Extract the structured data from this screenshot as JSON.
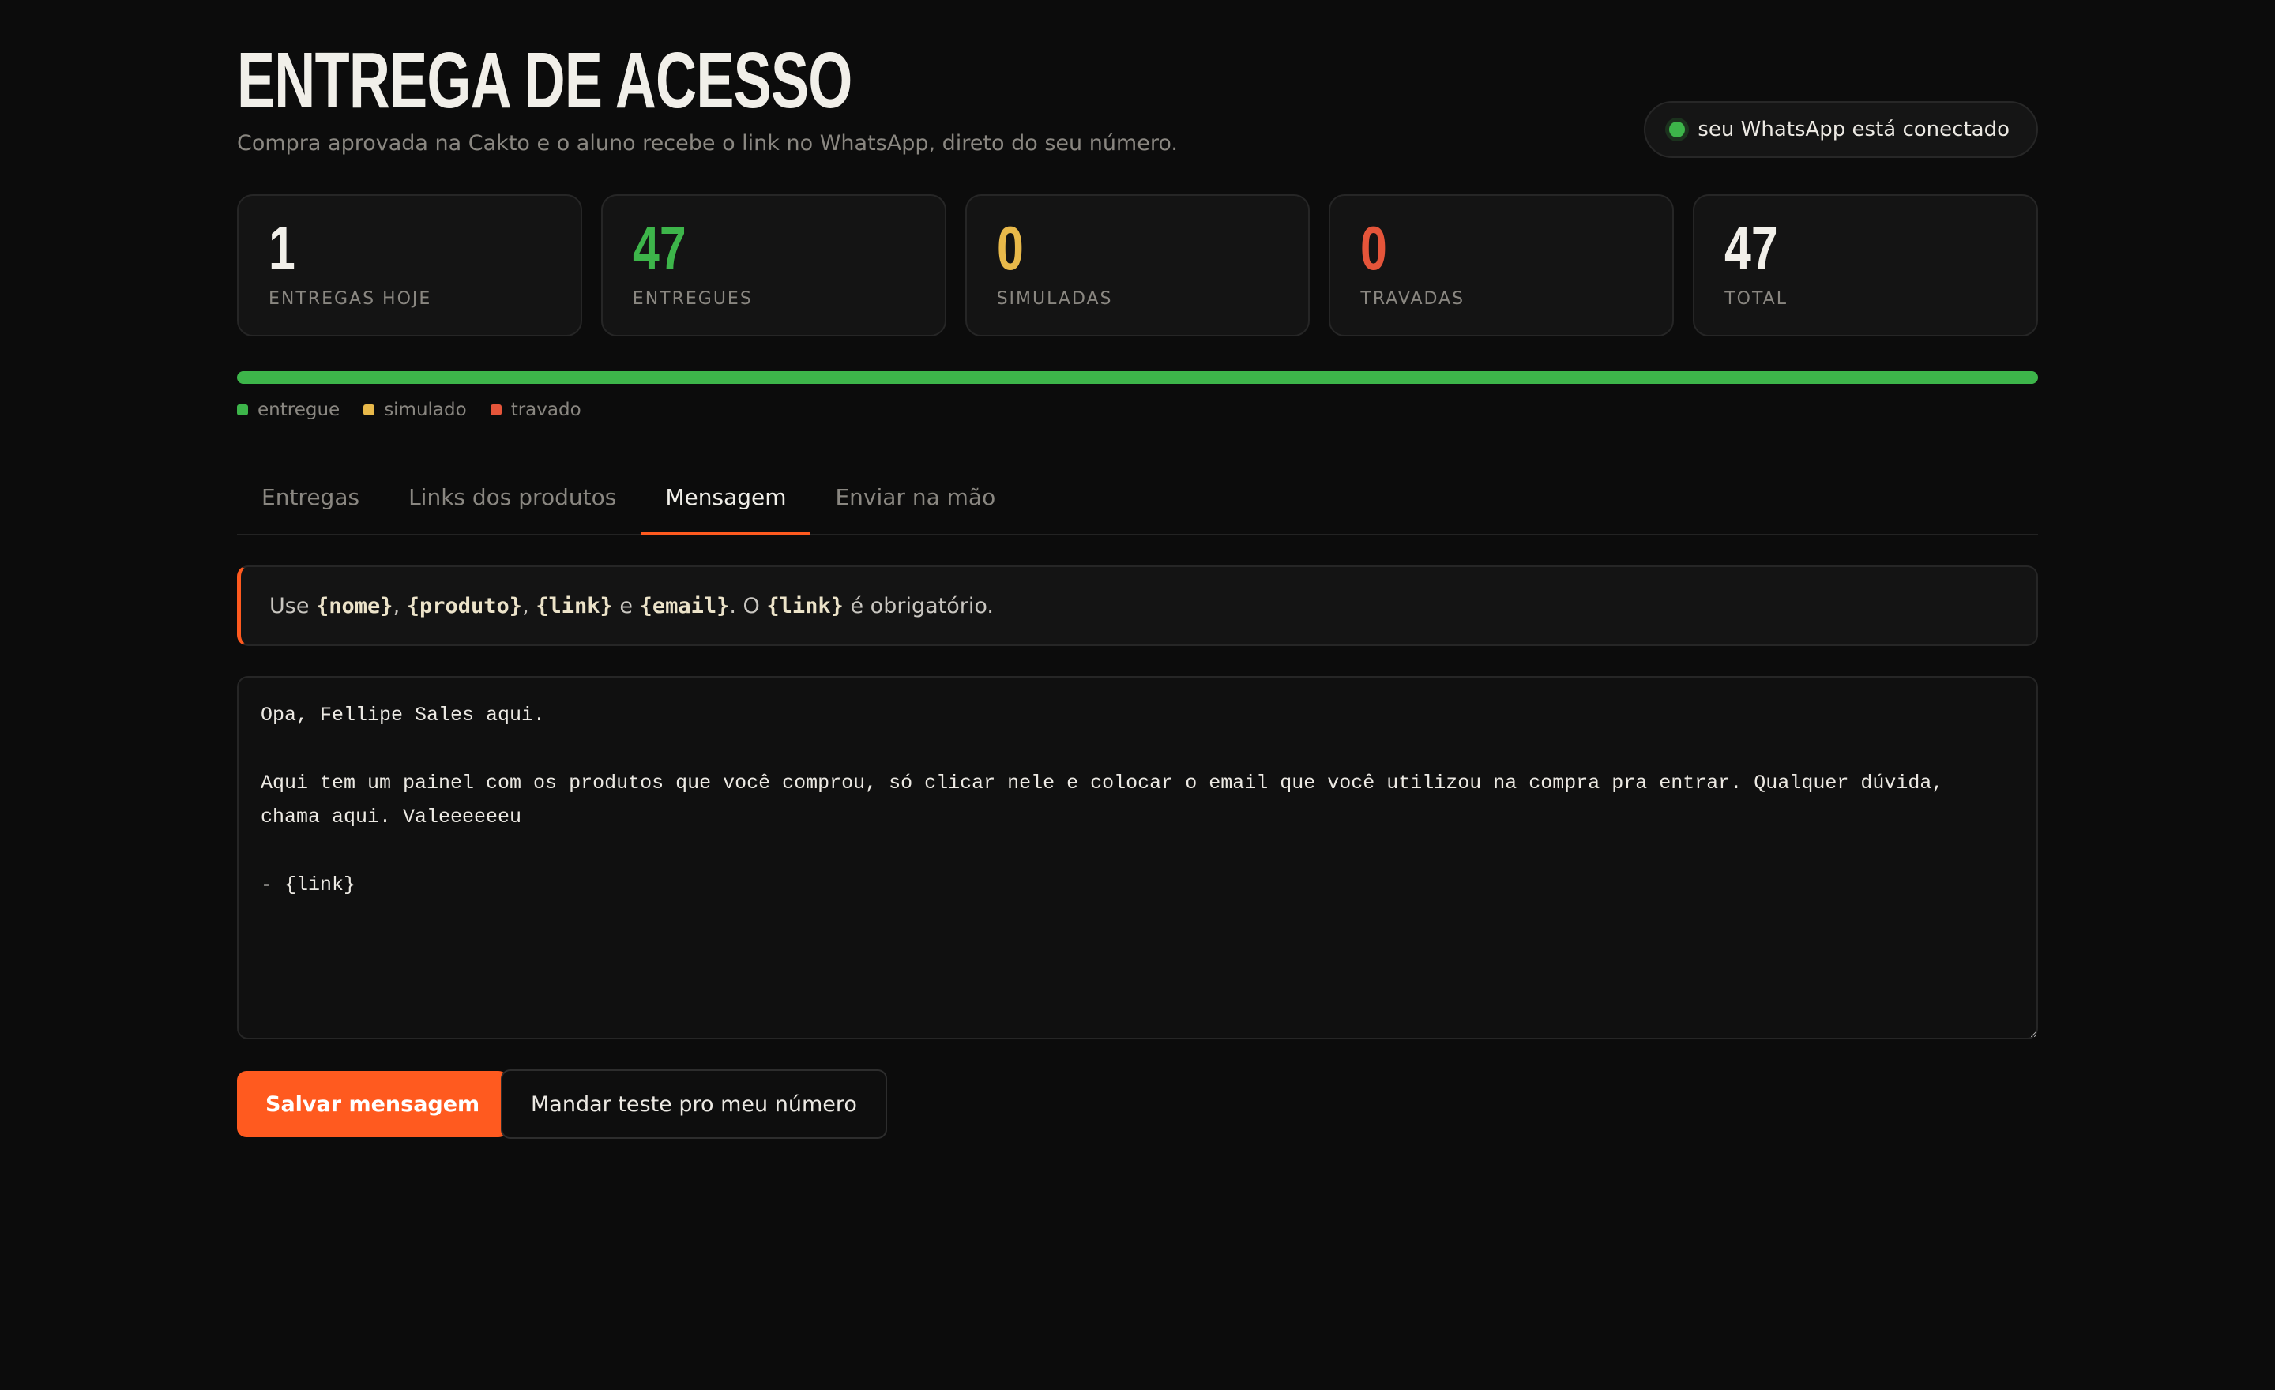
{
  "header": {
    "title": "ENTREGA DE ACESSO",
    "subtitle": "Compra aprovada na Cakto e o aluno recebe o link no WhatsApp, direto do seu número."
  },
  "whatsapp_status": {
    "label": "seu WhatsApp está conectado",
    "dot_color": "#3db54a"
  },
  "stats": [
    {
      "value": "1",
      "label": "ENTREGAS HOJE",
      "color": "#f1efe9"
    },
    {
      "value": "47",
      "label": "ENTREGUES",
      "color": "#3db54a"
    },
    {
      "value": "0",
      "label": "SIMULADAS",
      "color": "#e8b94a"
    },
    {
      "value": "0",
      "label": "TRAVADAS",
      "color": "#e5553a"
    },
    {
      "value": "47",
      "label": "TOTAL",
      "color": "#f1efe9"
    }
  ],
  "progress": {
    "entregue": 47,
    "simulado": 0,
    "travado": 0
  },
  "legend": [
    {
      "label": "entregue",
      "color": "#3db54a"
    },
    {
      "label": "simulado",
      "color": "#e8b94a"
    },
    {
      "label": "travado",
      "color": "#e5553a"
    }
  ],
  "tabs": [
    {
      "label": "Entregas",
      "active": false
    },
    {
      "label": "Links dos produtos",
      "active": false
    },
    {
      "label": "Mensagem",
      "active": true
    },
    {
      "label": "Enviar na mão",
      "active": false
    }
  ],
  "info": {
    "prefix": "Use ",
    "var_nome": "{nome}",
    "sep1": ", ",
    "var_produto": "{produto}",
    "sep2": ", ",
    "var_link": "{link}",
    "sep3": " e ",
    "var_email": "{email}",
    "sep4": ". O ",
    "var_link_required": "{link}",
    "suffix": " é obrigatório."
  },
  "message": {
    "value": "Opa, Fellipe Sales aqui.\n\nAqui tem um painel com os produtos que você comprou, só clicar nele e colocar o email que você utilizou na compra pra entrar. Qualquer dúvida, chama aqui. Valeeeeeeu\n\n- {link}"
  },
  "actions": {
    "save_label": "Salvar mensagem",
    "test_label": "Mandar teste pro meu número"
  },
  "colors": {
    "accent": "#ff5a1f",
    "background": "#0c0c0c"
  }
}
